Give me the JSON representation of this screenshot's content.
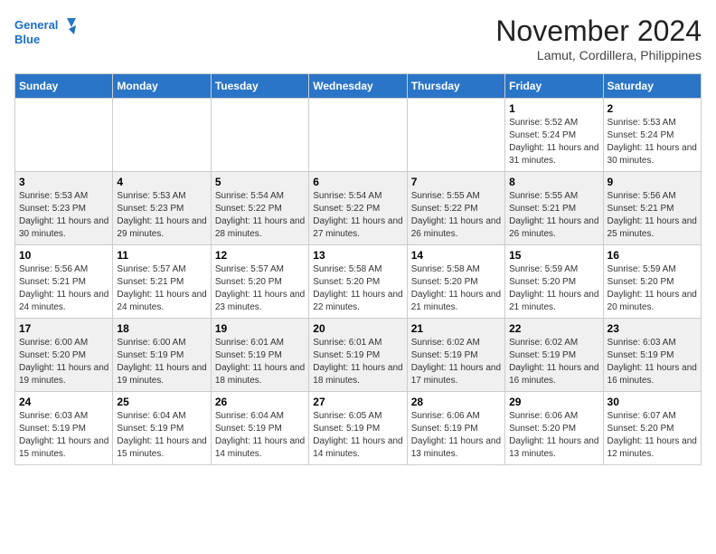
{
  "logo": {
    "line1": "General",
    "line2": "Blue"
  },
  "title": "November 2024",
  "location": "Lamut, Cordillera, Philippines",
  "days_header": [
    "Sunday",
    "Monday",
    "Tuesday",
    "Wednesday",
    "Thursday",
    "Friday",
    "Saturday"
  ],
  "weeks": [
    [
      {
        "day": "",
        "info": ""
      },
      {
        "day": "",
        "info": ""
      },
      {
        "day": "",
        "info": ""
      },
      {
        "day": "",
        "info": ""
      },
      {
        "day": "",
        "info": ""
      },
      {
        "day": "1",
        "info": "Sunrise: 5:52 AM\nSunset: 5:24 PM\nDaylight: 11 hours and 31 minutes."
      },
      {
        "day": "2",
        "info": "Sunrise: 5:53 AM\nSunset: 5:24 PM\nDaylight: 11 hours and 30 minutes."
      }
    ],
    [
      {
        "day": "3",
        "info": "Sunrise: 5:53 AM\nSunset: 5:23 PM\nDaylight: 11 hours and 30 minutes."
      },
      {
        "day": "4",
        "info": "Sunrise: 5:53 AM\nSunset: 5:23 PM\nDaylight: 11 hours and 29 minutes."
      },
      {
        "day": "5",
        "info": "Sunrise: 5:54 AM\nSunset: 5:22 PM\nDaylight: 11 hours and 28 minutes."
      },
      {
        "day": "6",
        "info": "Sunrise: 5:54 AM\nSunset: 5:22 PM\nDaylight: 11 hours and 27 minutes."
      },
      {
        "day": "7",
        "info": "Sunrise: 5:55 AM\nSunset: 5:22 PM\nDaylight: 11 hours and 26 minutes."
      },
      {
        "day": "8",
        "info": "Sunrise: 5:55 AM\nSunset: 5:21 PM\nDaylight: 11 hours and 26 minutes."
      },
      {
        "day": "9",
        "info": "Sunrise: 5:56 AM\nSunset: 5:21 PM\nDaylight: 11 hours and 25 minutes."
      }
    ],
    [
      {
        "day": "10",
        "info": "Sunrise: 5:56 AM\nSunset: 5:21 PM\nDaylight: 11 hours and 24 minutes."
      },
      {
        "day": "11",
        "info": "Sunrise: 5:57 AM\nSunset: 5:21 PM\nDaylight: 11 hours and 24 minutes."
      },
      {
        "day": "12",
        "info": "Sunrise: 5:57 AM\nSunset: 5:20 PM\nDaylight: 11 hours and 23 minutes."
      },
      {
        "day": "13",
        "info": "Sunrise: 5:58 AM\nSunset: 5:20 PM\nDaylight: 11 hours and 22 minutes."
      },
      {
        "day": "14",
        "info": "Sunrise: 5:58 AM\nSunset: 5:20 PM\nDaylight: 11 hours and 21 minutes."
      },
      {
        "day": "15",
        "info": "Sunrise: 5:59 AM\nSunset: 5:20 PM\nDaylight: 11 hours and 21 minutes."
      },
      {
        "day": "16",
        "info": "Sunrise: 5:59 AM\nSunset: 5:20 PM\nDaylight: 11 hours and 20 minutes."
      }
    ],
    [
      {
        "day": "17",
        "info": "Sunrise: 6:00 AM\nSunset: 5:20 PM\nDaylight: 11 hours and 19 minutes."
      },
      {
        "day": "18",
        "info": "Sunrise: 6:00 AM\nSunset: 5:19 PM\nDaylight: 11 hours and 19 minutes."
      },
      {
        "day": "19",
        "info": "Sunrise: 6:01 AM\nSunset: 5:19 PM\nDaylight: 11 hours and 18 minutes."
      },
      {
        "day": "20",
        "info": "Sunrise: 6:01 AM\nSunset: 5:19 PM\nDaylight: 11 hours and 18 minutes."
      },
      {
        "day": "21",
        "info": "Sunrise: 6:02 AM\nSunset: 5:19 PM\nDaylight: 11 hours and 17 minutes."
      },
      {
        "day": "22",
        "info": "Sunrise: 6:02 AM\nSunset: 5:19 PM\nDaylight: 11 hours and 16 minutes."
      },
      {
        "day": "23",
        "info": "Sunrise: 6:03 AM\nSunset: 5:19 PM\nDaylight: 11 hours and 16 minutes."
      }
    ],
    [
      {
        "day": "24",
        "info": "Sunrise: 6:03 AM\nSunset: 5:19 PM\nDaylight: 11 hours and 15 minutes."
      },
      {
        "day": "25",
        "info": "Sunrise: 6:04 AM\nSunset: 5:19 PM\nDaylight: 11 hours and 15 minutes."
      },
      {
        "day": "26",
        "info": "Sunrise: 6:04 AM\nSunset: 5:19 PM\nDaylight: 11 hours and 14 minutes."
      },
      {
        "day": "27",
        "info": "Sunrise: 6:05 AM\nSunset: 5:19 PM\nDaylight: 11 hours and 14 minutes."
      },
      {
        "day": "28",
        "info": "Sunrise: 6:06 AM\nSunset: 5:19 PM\nDaylight: 11 hours and 13 minutes."
      },
      {
        "day": "29",
        "info": "Sunrise: 6:06 AM\nSunset: 5:20 PM\nDaylight: 11 hours and 13 minutes."
      },
      {
        "day": "30",
        "info": "Sunrise: 6:07 AM\nSunset: 5:20 PM\nDaylight: 11 hours and 12 minutes."
      }
    ]
  ]
}
